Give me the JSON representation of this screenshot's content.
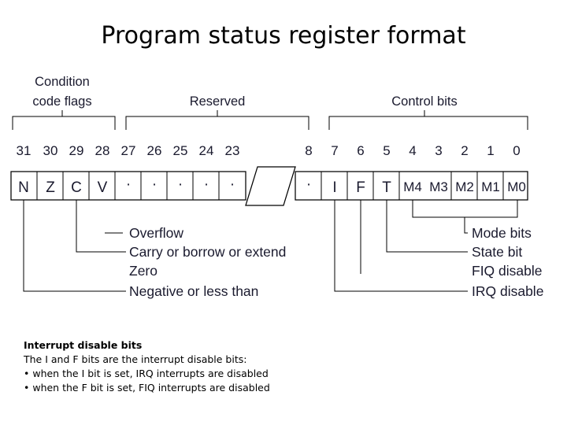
{
  "slide": {
    "title": "Program status register format",
    "background": "#ffffff",
    "line_color": "#000000",
    "text_color": "#15151f"
  },
  "group_labels": [
    {
      "id": "condition-code-flags",
      "line1": "Condition",
      "line2": "code flags"
    },
    {
      "id": "reserved",
      "line1": "Reserved",
      "line2": ""
    },
    {
      "id": "control-bits",
      "line1": "Control bits",
      "line2": ""
    }
  ],
  "bit_numbers": [
    "31",
    "30",
    "29",
    "28",
    "27",
    "26",
    "25",
    "24",
    "23",
    "8",
    "7",
    "6",
    "5",
    "4",
    "3",
    "2",
    "1",
    "0"
  ],
  "register_cells": [
    {
      "bit": "31",
      "label": "N"
    },
    {
      "bit": "30",
      "label": "Z"
    },
    {
      "bit": "29",
      "label": "C"
    },
    {
      "bit": "28",
      "label": "V"
    },
    {
      "bit": "27",
      "label": "·"
    },
    {
      "bit": "26",
      "label": "·"
    },
    {
      "bit": "25",
      "label": "·"
    },
    {
      "bit": "24",
      "label": "·"
    },
    {
      "bit": "23",
      "label": "·"
    },
    {
      "bit": "8",
      "label": "·"
    },
    {
      "bit": "7",
      "label": "I"
    },
    {
      "bit": "6",
      "label": "F"
    },
    {
      "bit": "5",
      "label": "T"
    },
    {
      "bit": "4",
      "label": "M4"
    },
    {
      "bit": "3",
      "label": "M3"
    },
    {
      "bit": "2",
      "label": "M2"
    },
    {
      "bit": "1",
      "label": "M1"
    },
    {
      "bit": "0",
      "label": "M0"
    }
  ],
  "annotations_left": [
    {
      "id": "overflow",
      "text": "Overflow",
      "from_bit": "28"
    },
    {
      "id": "carry",
      "text": "Carry or borrow or extend",
      "from_bit": "29"
    },
    {
      "id": "zero",
      "text": "Zero",
      "from_bit": "30"
    },
    {
      "id": "negative",
      "text": "Negative or less than",
      "from_bit": "31"
    }
  ],
  "annotations_right": [
    {
      "id": "mode-bits",
      "text": "Mode bits",
      "from_bit": "M4-M0"
    },
    {
      "id": "state-bit",
      "text": "State bit",
      "from_bit": "5"
    },
    {
      "id": "fiq-disable",
      "text": "FIQ disable",
      "from_bit": "6"
    },
    {
      "id": "irq-disable",
      "text": "IRQ disable",
      "from_bit": "7"
    }
  ],
  "notes": {
    "heading": "Interrupt disable bits",
    "line1": "The I and F bits are the interrupt disable bits:",
    "bullet1": "• when the I bit is set, IRQ interrupts are disabled",
    "bullet2": "• when the F bit is set, FIQ interrupts are disabled"
  }
}
